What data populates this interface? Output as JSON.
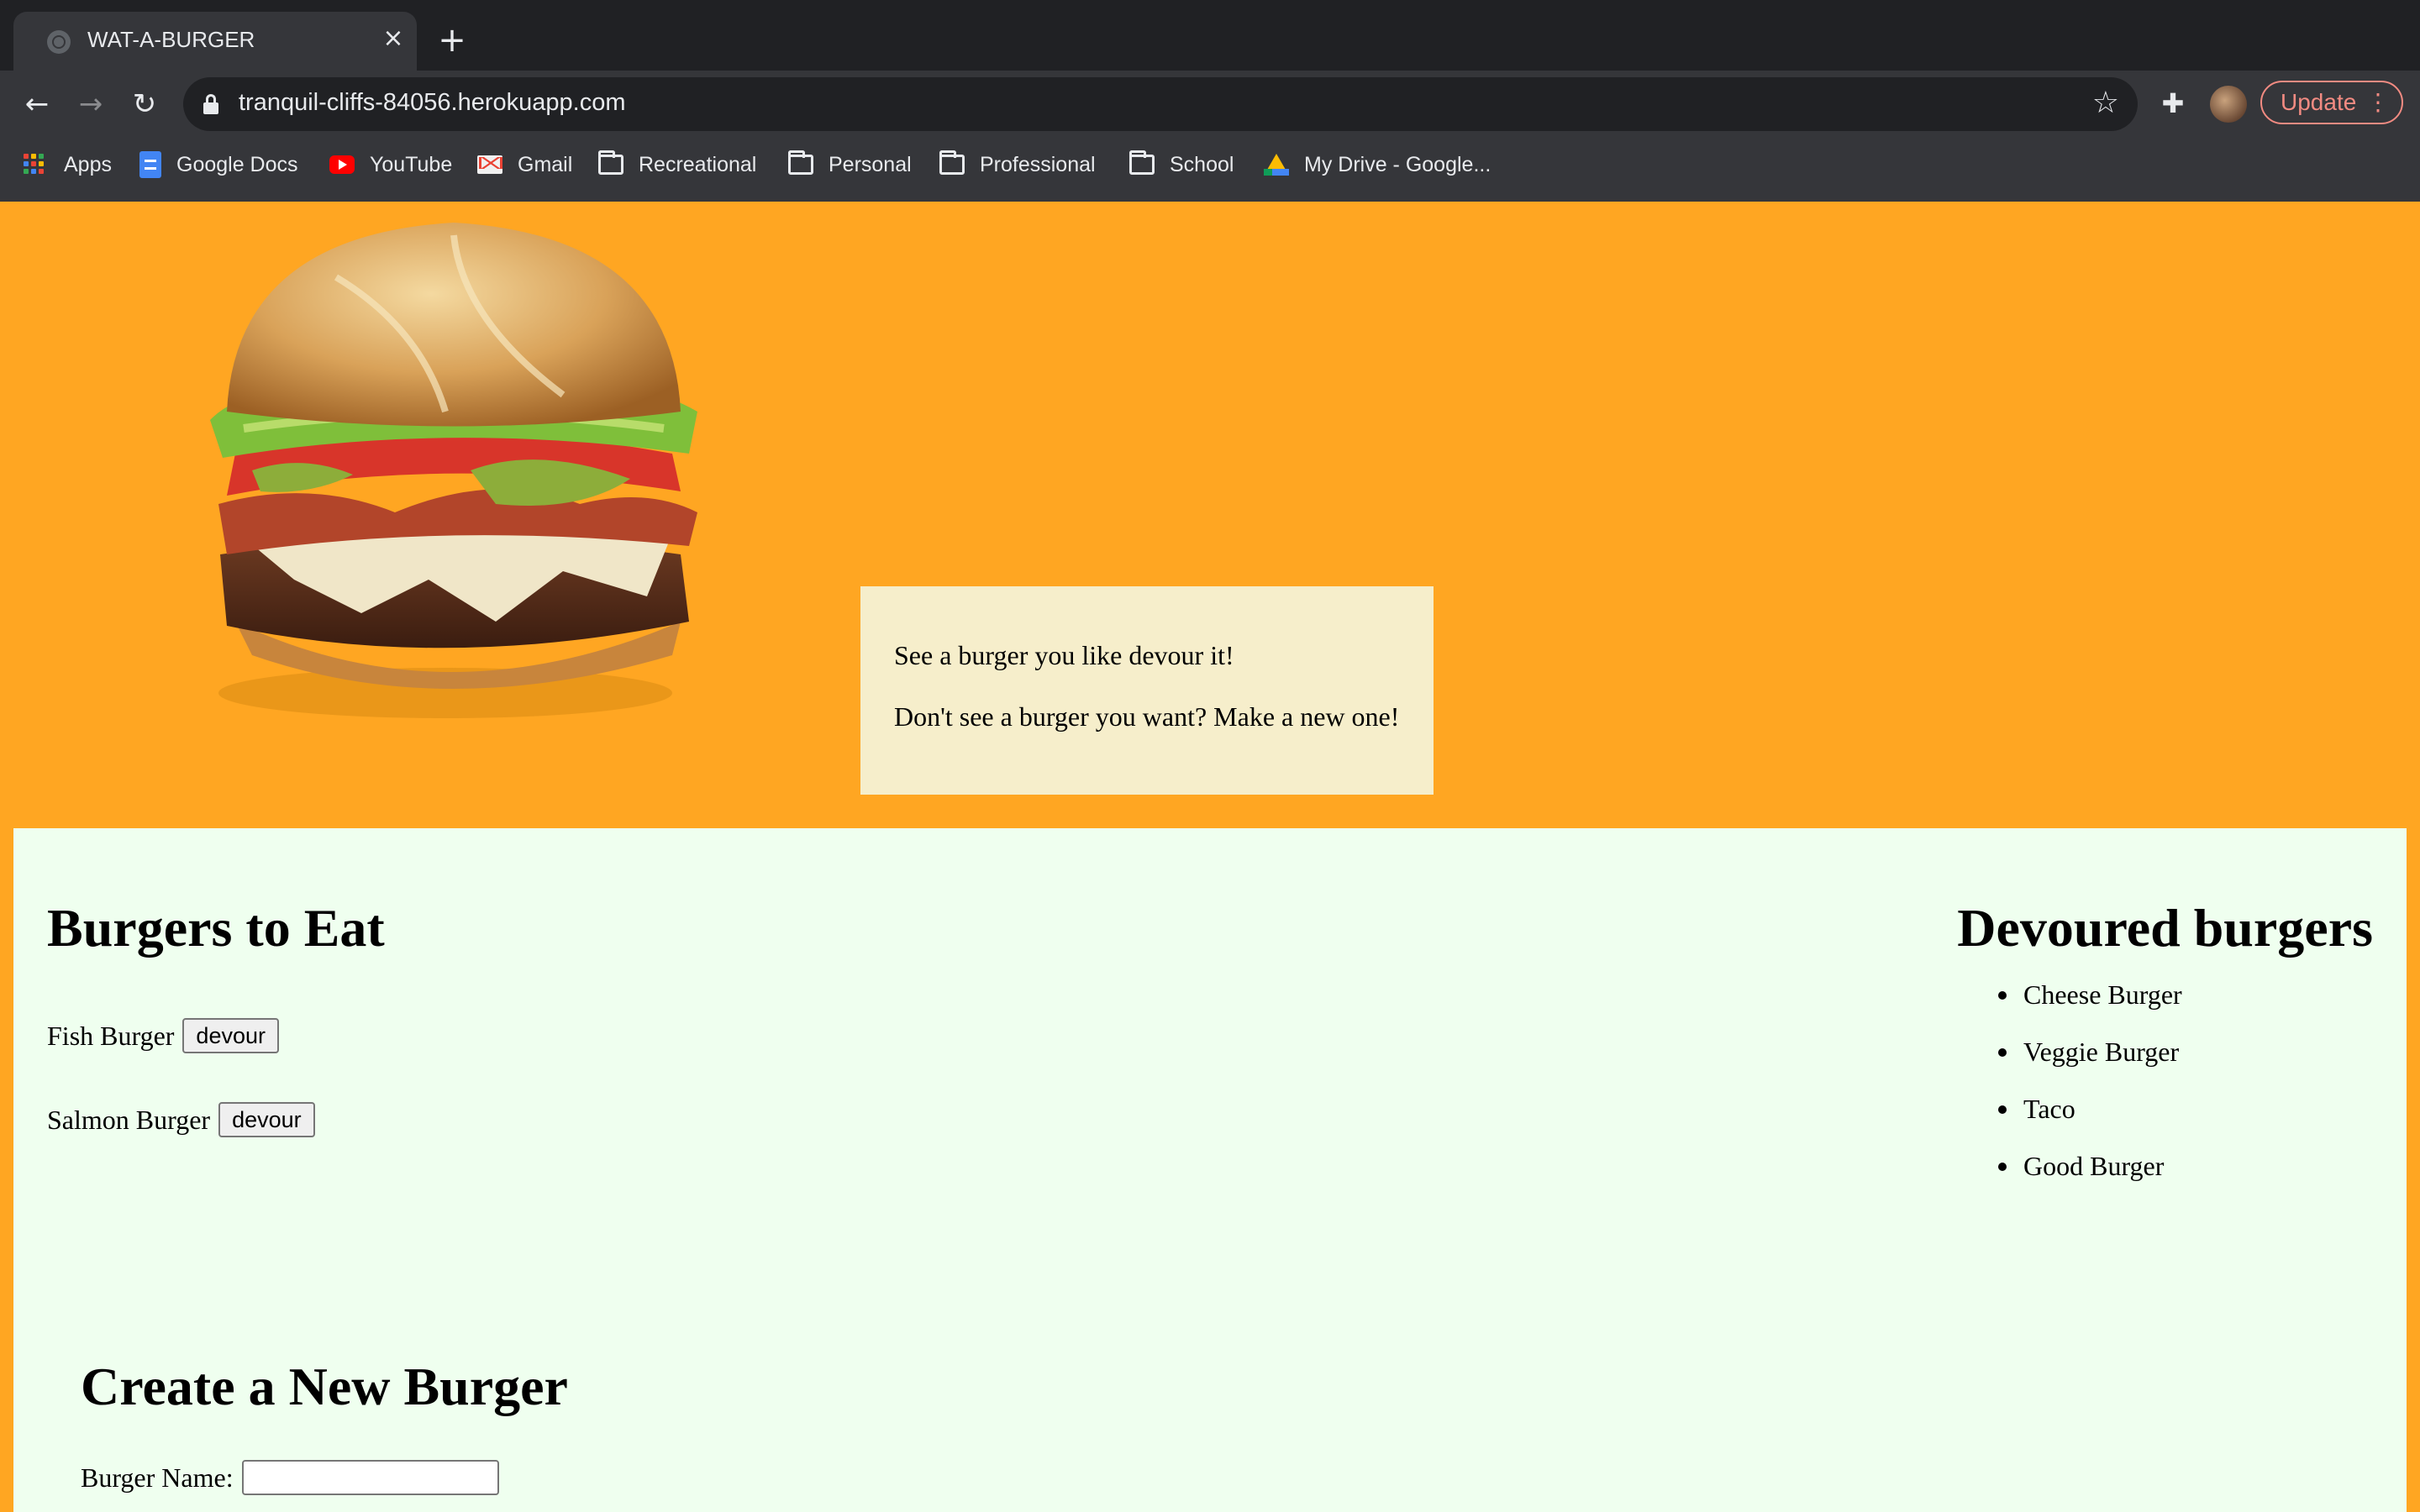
{
  "browser": {
    "tab_title": "WAT-A-BURGER",
    "url": "tranquil-cliffs-84056.herokuapp.com",
    "update_label": "Update",
    "bookmarks": [
      "Apps",
      "Google Docs",
      "YouTube",
      "Gmail",
      "Recreational",
      "Personal",
      "Professional",
      "School",
      "My Drive - Google..."
    ],
    "icons": {
      "back": "arrow-left-icon",
      "forward": "arrow-right-icon",
      "reload": "reload-icon",
      "secure": "lock-icon",
      "bookmark": "star-icon",
      "extensions": "puzzle-icon"
    }
  },
  "intro": {
    "line1": "See a burger you like devour it!",
    "line2": "Don't see a burger you want? Make a new one!"
  },
  "to_eat": {
    "heading": "Burgers to Eat",
    "button_label": "devour",
    "items": [
      "Fish Burger",
      "Salmon Burger"
    ]
  },
  "devoured": {
    "heading": "Devoured burgers",
    "items": [
      "Cheese Burger",
      "Veggie Burger",
      "Taco",
      "Good Burger"
    ]
  },
  "create": {
    "heading": "Create a New Burger",
    "name_label": "Burger Name:",
    "name_value": ""
  },
  "colors": {
    "page_background": "#ffa622",
    "intro_box": "#f6eecb",
    "main_panel": "#efffef",
    "chrome_dark": "#202124",
    "chrome_toolbar": "#35363a",
    "update_accent": "#f28b82"
  }
}
